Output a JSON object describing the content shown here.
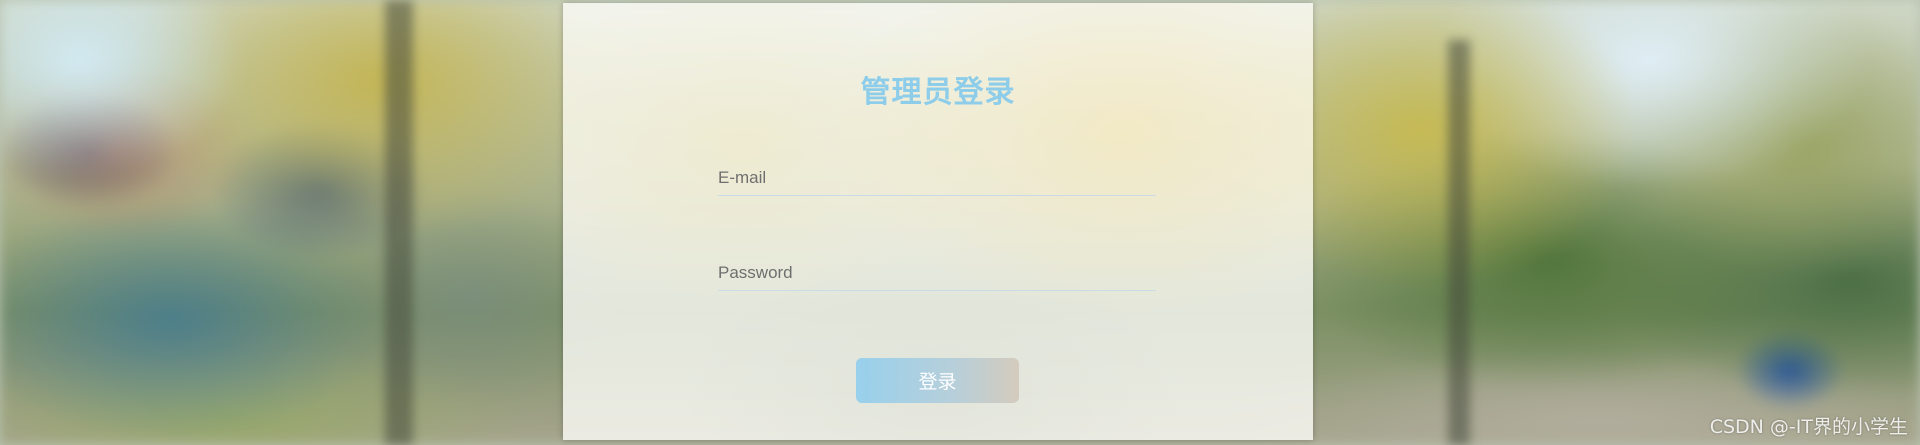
{
  "login": {
    "title": "管理员登录",
    "email": {
      "placeholder": "E-mail",
      "value": ""
    },
    "password": {
      "placeholder": "Password",
      "value": ""
    },
    "submit_label": "登录"
  },
  "watermark": "CSDN @-IT界的小学生",
  "colors": {
    "title": "#8ecdea",
    "button_gradient_start": "#98d0ec",
    "button_gradient_end": "#d4cbbd",
    "field_underline": "#c9dbe6",
    "card_background": "#fafaf5"
  }
}
